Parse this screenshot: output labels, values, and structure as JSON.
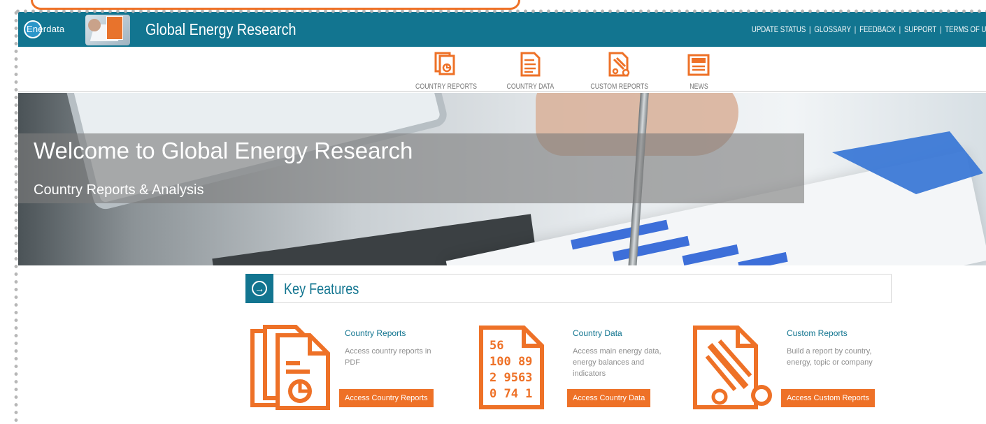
{
  "colors": {
    "header_bg": "#127590",
    "accent_orange": "#ee7127",
    "feature_title": "#127590",
    "muted_text": "#8f8f8f"
  },
  "header": {
    "logo_text": "Enerdata",
    "site_title": "Global Energy Research",
    "links": [
      "UPDATE STATUS",
      "GLOSSARY",
      "FEEDBACK",
      "SUPPORT",
      "TERMS OF U"
    ]
  },
  "nav": {
    "items": [
      {
        "label": "COUNTRY REPORTS",
        "icon": "country-reports-icon"
      },
      {
        "label": "COUNTRY DATA",
        "icon": "country-data-icon"
      },
      {
        "label": "CUSTOM REPORTS",
        "icon": "custom-reports-icon"
      },
      {
        "label": "NEWS",
        "icon": "news-icon"
      }
    ]
  },
  "hero": {
    "title": "Welcome to Global Energy Research",
    "subtitle": "Country Reports & Analysis"
  },
  "key_features": {
    "title": "Key Features",
    "items": [
      {
        "title": "Country Reports",
        "description": "Access country reports in PDF",
        "button": "Access Country Reports",
        "icon": "documents-pie-icon"
      },
      {
        "title": "Country Data",
        "description": "Access main energy data, energy balances and indicators",
        "button": "Access Country Data",
        "icon": "data-sheet-icon",
        "icon_numbers": "56\n100 89\n2 9563\n0 74 1"
      },
      {
        "title": "Custom Reports",
        "description": "Build a report by country, energy, topic or company",
        "button": "Access Custom Reports",
        "icon": "scissors-report-icon"
      }
    ]
  }
}
